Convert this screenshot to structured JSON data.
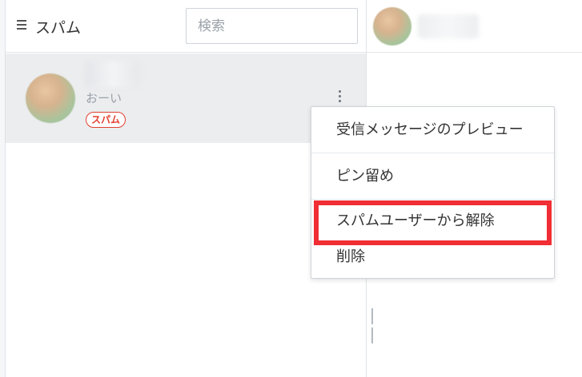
{
  "header": {
    "folder_title": "スパム",
    "search_placeholder": "検索"
  },
  "conversation": {
    "preview": "おーい",
    "badge": "スパム"
  },
  "context_menu": {
    "items": [
      {
        "label": "受信メッセージのプレビュー"
      },
      {
        "label": "ピン留め"
      },
      {
        "label": "スパムユーザーから解除"
      },
      {
        "label": "削除"
      }
    ]
  },
  "colors": {
    "accent_red": "#f02e34",
    "badge_red": "#e2402f",
    "selected_row": "#ebedef"
  },
  "icons": {
    "menu": "hamburger-menu-icon",
    "more": "kebab-more-icon",
    "resize": "resize-handle-icon"
  }
}
